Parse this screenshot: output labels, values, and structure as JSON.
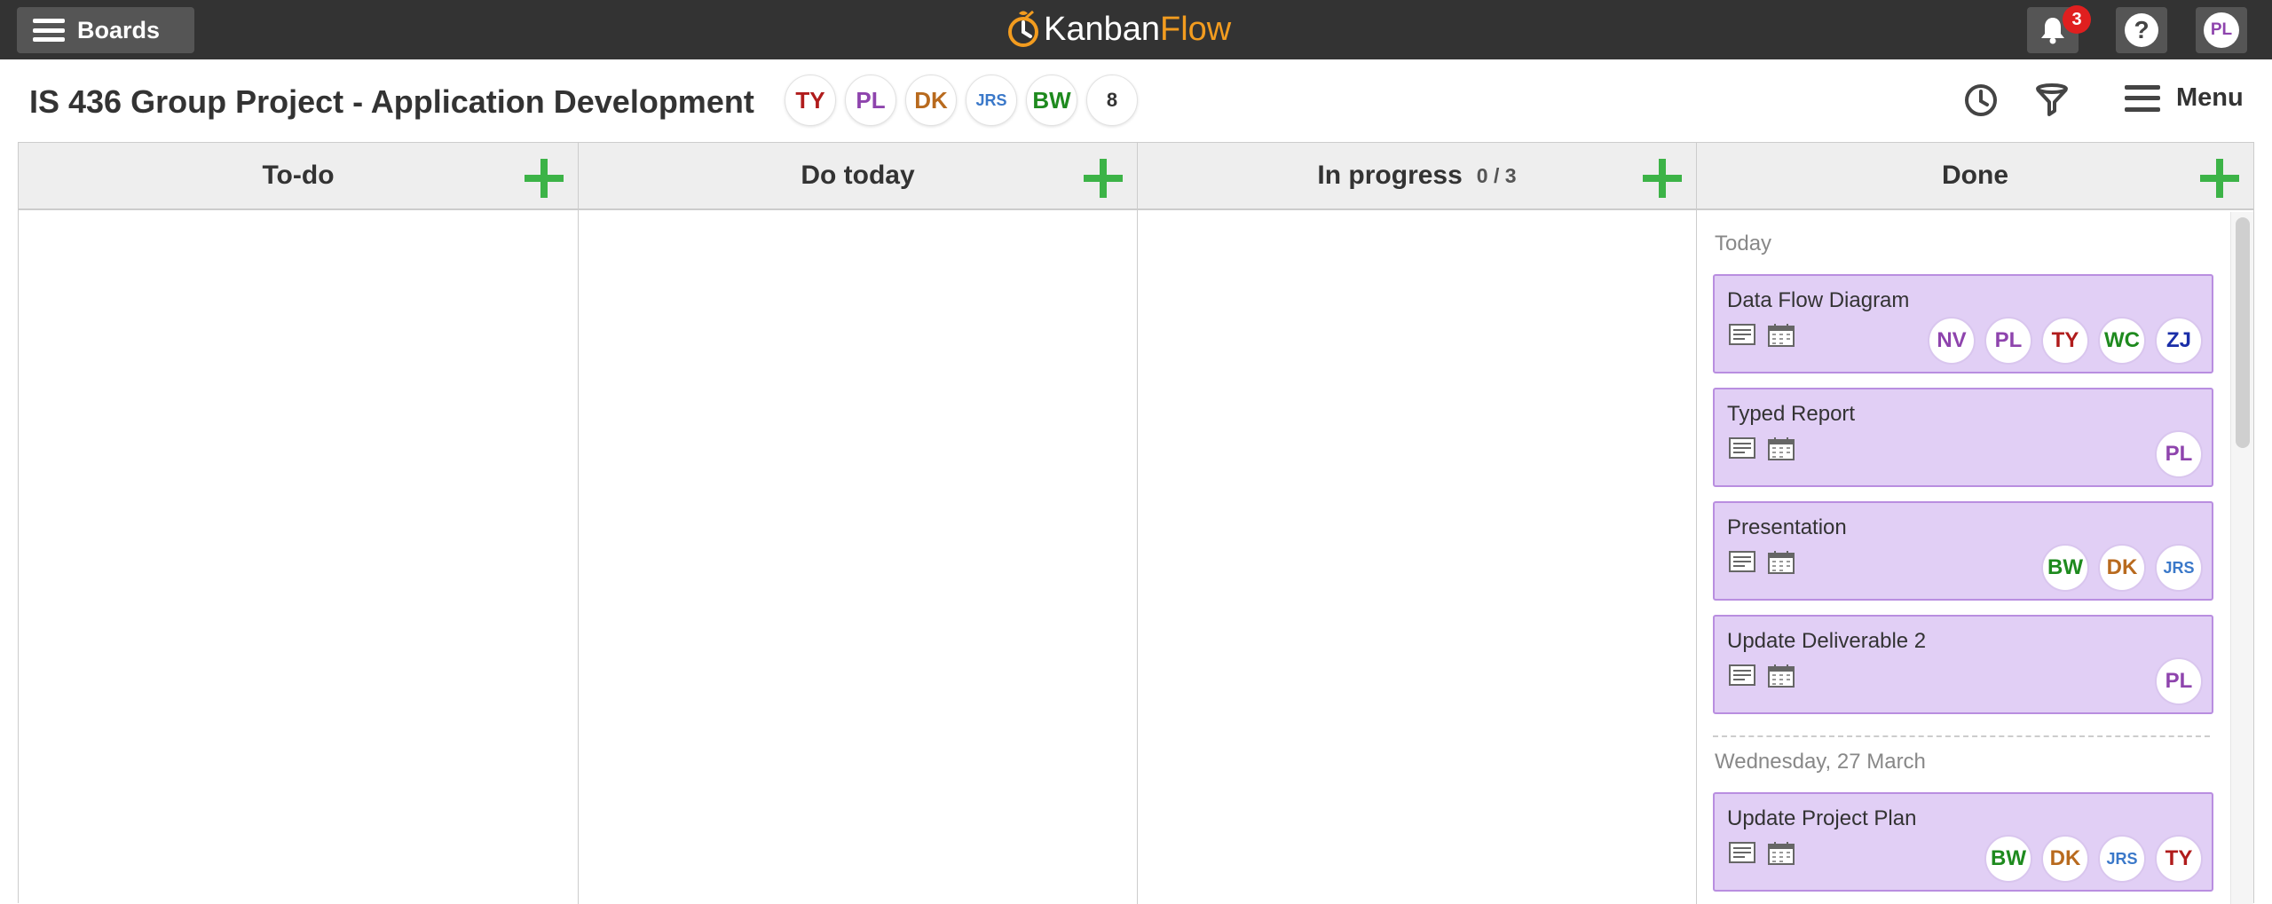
{
  "topbar": {
    "boards_label": "Boards",
    "logo_kanban": "Kanban",
    "logo_flow": "Flow",
    "notification_count": "3",
    "help_symbol": "?",
    "user_initials": "PL"
  },
  "board": {
    "title": "IS 436 Group Project - Application Development",
    "members": [
      {
        "initials": "TY",
        "color": "#b01c1c"
      },
      {
        "initials": "PL",
        "color": "#8e44ad"
      },
      {
        "initials": "DK",
        "color": "#b86a1e"
      },
      {
        "initials": "JRS",
        "color": "#3a78c9"
      },
      {
        "initials": "BW",
        "color": "#1e8a1e"
      }
    ],
    "member_count": "8",
    "menu_label": "Menu",
    "icons": [
      "clock-icon",
      "filter-icon",
      "menu-icon"
    ]
  },
  "columns": [
    {
      "name": "To-do",
      "wip": ""
    },
    {
      "name": "Do today",
      "wip": ""
    },
    {
      "name": "In progress",
      "wip": "0 / 3"
    },
    {
      "name": "Done",
      "wip": ""
    }
  ],
  "done": {
    "groups": [
      {
        "label": "Today",
        "cards": [
          {
            "title": "Data Flow Diagram",
            "assignees": [
              "NV",
              "PL",
              "TY",
              "WC",
              "ZJ"
            ]
          },
          {
            "title": "Typed Report",
            "assignees": [
              "PL"
            ]
          },
          {
            "title": "Presentation",
            "assignees": [
              "BW",
              "DK",
              "JRS"
            ]
          },
          {
            "title": "Update Deliverable 2",
            "assignees": [
              "PL"
            ]
          }
        ]
      },
      {
        "label": "Wednesday, 27 March",
        "cards": [
          {
            "title": "Update Project Plan",
            "assignees": [
              "BW",
              "DK",
              "JRS",
              "TY"
            ]
          }
        ]
      }
    ]
  },
  "colors": {
    "topbar": "#333333",
    "accent_green": "#3cb347",
    "card_bg": "#e1cff5",
    "card_border": "#b98ee0",
    "logo_orange": "#f39c1f",
    "initials": {
      "TY": "#b01c1c",
      "PL": "#8e44ad",
      "DK": "#b86a1e",
      "JRS": "#3a78c9",
      "BW": "#1e8a1e",
      "NV": "#8e44ad",
      "WC": "#1e8a1e",
      "ZJ": "#1a2ea8"
    }
  }
}
